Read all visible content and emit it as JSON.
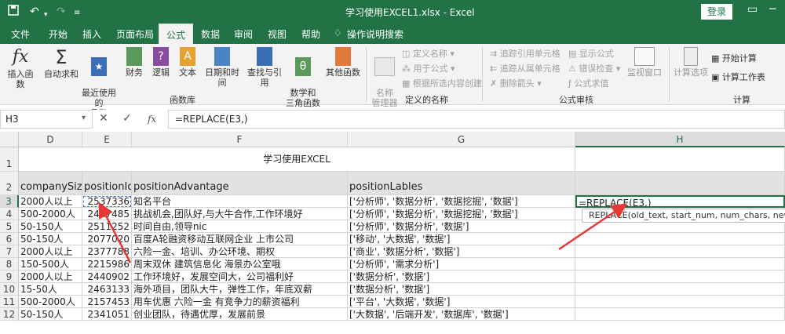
{
  "titlebar": {
    "document_title": "学习使用EXCEL1.xlsx  -  Excel",
    "login": "登录",
    "save_icon": "save-icon",
    "undo_icon": "undo-icon",
    "redo_icon": "redo-icon"
  },
  "tabs": [
    "文件",
    "开始",
    "插入",
    "页面布局",
    "公式",
    "数据",
    "审阅",
    "视图",
    "帮助",
    "操作说明搜索"
  ],
  "active_tab": "公式",
  "ribbon": {
    "function_library": {
      "label": "函数库",
      "buttons": [
        "插入函数",
        "自动求和",
        "最近使用的\n函数",
        "财务",
        "逻辑",
        "文本",
        "日期和时间",
        "查找与引用",
        "数学和\n三角函数",
        "其他函数"
      ]
    },
    "defined_names": {
      "label": "定义的名称",
      "name_manager": "名称\n管理器",
      "items": [
        "定义名称",
        "用于公式",
        "根据所选内容创建"
      ]
    },
    "formula_auditing": {
      "label": "公式审核",
      "items": [
        "追踪引用单元格",
        "追踪从属单元格",
        "删除箭头",
        "显示公式",
        "错误检查",
        "公式求值"
      ],
      "watch": "监视窗口"
    },
    "calculation": {
      "label": "计算",
      "options": "计算选项",
      "items": [
        "开始计算",
        "计算工作表"
      ]
    }
  },
  "formula_bar": {
    "name_box": "H3",
    "cancel": "✕",
    "enter": "✓",
    "fx": "fx",
    "formula": "=REPLACE(E3,)"
  },
  "columns": [
    "D",
    "E",
    "F",
    "G",
    "H"
  ],
  "rows": [
    "1",
    "2",
    "3",
    "4",
    "5",
    "6",
    "7",
    "8",
    "9",
    "10",
    "11",
    "12"
  ],
  "sheet": {
    "title": "学习使用EXCEL",
    "headers": [
      "companySize",
      "positionId",
      "positionAdvantage",
      "positionLables",
      ""
    ],
    "data": [
      [
        "2000人以上",
        "2537336",
        "知名平台",
        "['分析师', '数据分析', '数据挖掘', '数据']",
        "=REPLACE(E3,)"
      ],
      [
        "500-2000人",
        "2427485",
        "挑战机会,团队好,与大牛合作,工作环境好",
        "['分析师', '数据分析', '数据挖掘', '数据']",
        ""
      ],
      [
        "50-150人",
        "2511252",
        "时间自由,领导nic",
        "['分析师', '数据分析', '数据']",
        ""
      ],
      [
        "50-150人",
        "2077020",
        "百度A轮融资移动互联网企业 上市公司",
        "['移动', '大数据', '数据']",
        ""
      ],
      [
        "2000人以上",
        "2377788",
        "六险一金、培训、办公环境、期权",
        "['商业', '数据分析', '数据']",
        ""
      ],
      [
        "150-500人",
        "2215986",
        "周末双休 建筑信息化 海景办公室哦",
        "['分析师', '需求分析']",
        ""
      ],
      [
        "2000人以上",
        "2440902",
        "工作环境好，发展空间大，公司福利好",
        "['数据分析', '数据']",
        ""
      ],
      [
        "15-50人",
        "2463133",
        "海外项目，团队大牛，弹性工作，年底双薪",
        "['数据分析', '数据']",
        ""
      ],
      [
        "500-2000人",
        "2157453",
        "用车优惠 六险一金 有竞争力的薪资福利",
        "['平台', '大数据', '数据']",
        ""
      ],
      [
        "50-150人",
        "2341051",
        "创业团队，待遇优厚，发展前景",
        "['大数据', '后端开发', '数据库', '数据']",
        ""
      ]
    ]
  },
  "tooltip": "REPLACE(old_text, start_num, num_chars, new_text)"
}
